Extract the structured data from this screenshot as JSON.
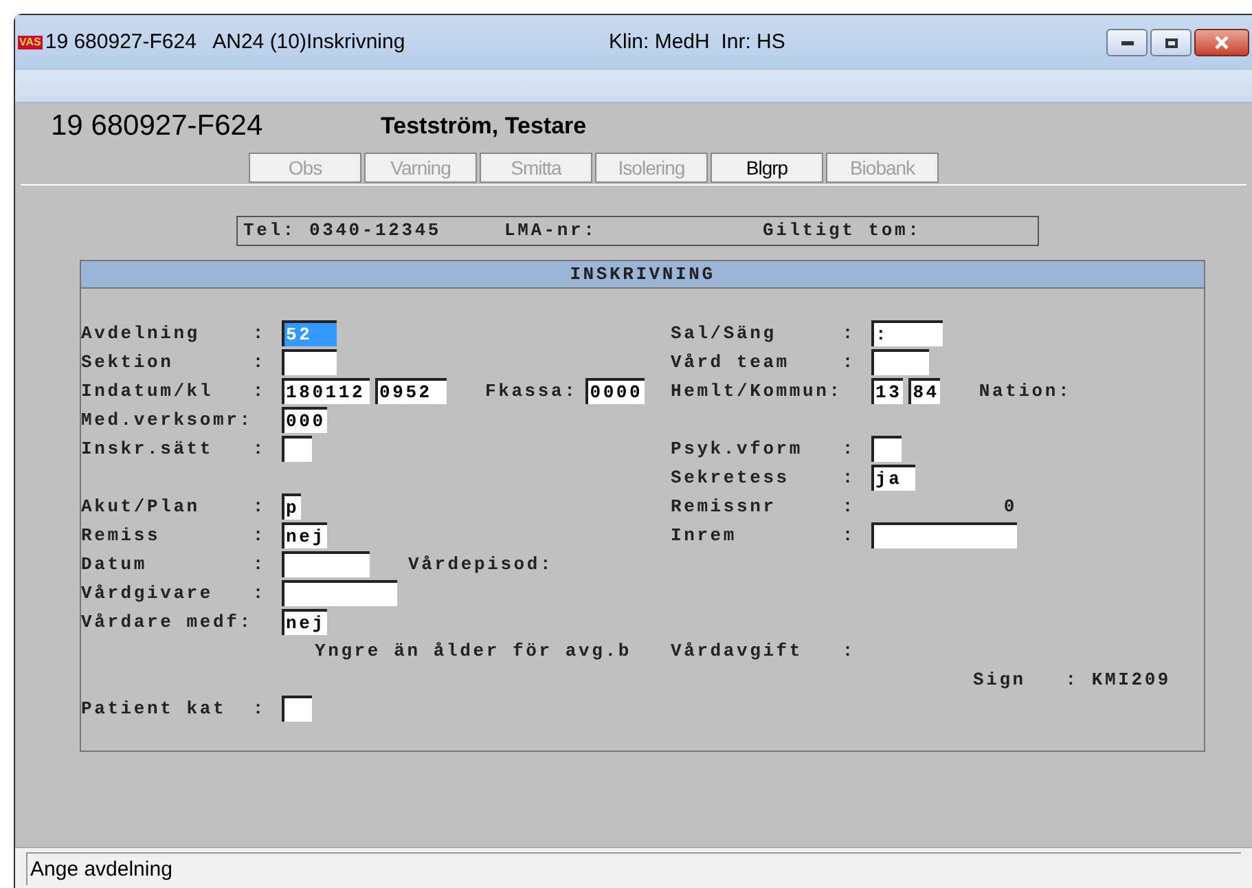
{
  "window": {
    "title": "19 680927-F624   AN24 (10)Inskrivning",
    "context": "Klin: MedH  Inr: HS",
    "app_badge": "VAS"
  },
  "patient": {
    "id": "19 680927-F624",
    "name": "Testström, Testare"
  },
  "buttons": [
    {
      "label": "Obs",
      "disabled": true
    },
    {
      "label": "Varning",
      "disabled": true
    },
    {
      "label": "Smitta",
      "disabled": true
    },
    {
      "label": "Isolering",
      "disabled": true
    },
    {
      "label": "Blgrp",
      "disabled": false
    },
    {
      "label": "Biobank",
      "disabled": true
    }
  ],
  "info_bar": [
    "Tel: 0340-12345",
    "LMA-nr:",
    "Giltigt tom:"
  ],
  "panel": {
    "title": "INSKRIVNING",
    "left": [
      [
        {
          "label": "Avdelning    :",
          "fields": [
            {
              "value": "52",
              "selected": true
            }
          ]
        },
        {
          "label": "Sektion      :",
          "fields": [
            {
              "selected": false
            }
          ]
        },
        {
          "label": "Indatum/kl   :",
          "fields": [
            {
              "value": "180112",
              "selected": false
            },
            {
              "value": "0952",
              "selected": false
            }
          ],
          "after": "Fkassa:",
          "after_fields": [
            {
              "value": "0000",
              "selected": false
            }
          ]
        },
        {
          "label": "Med.verksomr:",
          "fields": [
            {
              "value": "000",
              "selected": false
            }
          ]
        },
        {
          "label": "Inskr.sätt   :",
          "fields": [
            {
              "selected": false
            }
          ]
        }
      ],
      [
        {
          "label": "Akut/Plan    :",
          "fields": [
            {
              "value": "p",
              "selected": false
            }
          ]
        },
        {
          "label": "Remiss       :",
          "fields": [
            {
              "value": "nej",
              "selected": false
            }
          ]
        },
        {
          "label": "Datum        :",
          "fields": [
            {
              "selected": false
            }
          ],
          "after": "Vårdepisod:"
        },
        {
          "label": "Vårdgivare   :",
          "fields": [
            {
              "selected": false
            }
          ]
        },
        {
          "label": "Vårdare medf:",
          "fields": [
            {
              "value": "nej",
              "selected": false
            }
          ]
        }
      ]
    ],
    "right": [
      [
        {
          "label": "Sal/Säng     :",
          "fields": [
            {
              "value": ":",
              "selected": false
            }
          ]
        },
        {
          "label": "Vård team    :",
          "fields": [
            {
              "selected": false
            }
          ]
        },
        {
          "label": "Hemlt/Kommun:",
          "fields": [
            {
              "value": "13",
              "selected": false
            },
            {
              "value": "84",
              "selected": false
            }
          ],
          "after": "Nation:"
        }
      ],
      [
        {
          "label": "Psyk.vform   :",
          "fields": [
            {
              "selected": false
            }
          ]
        },
        {
          "label": "Sekretess    :",
          "fields": [
            {
              "value": "ja",
              "selected": false
            }
          ]
        },
        {
          "label": "Remissnr     :",
          "readonly": "0"
        },
        {
          "label": "Inrem        :",
          "fields": [
            {
              "selected": false
            }
          ]
        }
      ]
    ],
    "footer": [
      {
        "note": "Yngre än ålder för avg.b",
        "label": "Vårdavgift   :"
      },
      {
        "sign": "Sign   : KMI209"
      },
      {
        "label": "Patient kat  :",
        "fields": [
          {
            "selected": false
          }
        ]
      }
    ]
  },
  "status_bar": "Ange avdelning"
}
